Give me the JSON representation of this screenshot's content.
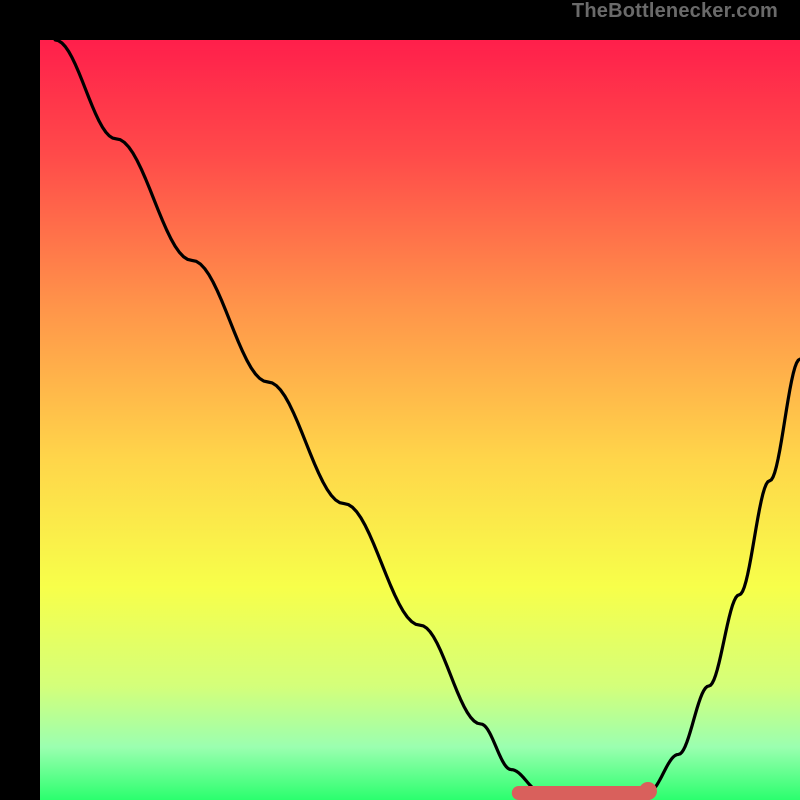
{
  "watermark": {
    "text": "TheBottlenecker.com"
  },
  "chart_data": {
    "type": "line",
    "title": "",
    "xlabel": "",
    "ylabel": "",
    "xlim": [
      0,
      100
    ],
    "ylim": [
      0,
      100
    ],
    "curve_description": "V-shaped curve over vertical rainbow gradient; left branch starts at top-left and descends to a flat trough near x≈64–80 at y≈0, then rises toward upper-right.",
    "series": [
      {
        "name": "bottleneck-curve",
        "color": "#000000",
        "x": [
          2,
          10,
          20,
          30,
          40,
          50,
          58,
          62,
          66,
          70,
          74,
          78,
          80,
          84,
          88,
          92,
          96,
          100
        ],
        "y": [
          100,
          87,
          71,
          55,
          39,
          23,
          10,
          4,
          1,
          0,
          0,
          0,
          1,
          6,
          15,
          27,
          42,
          58
        ]
      }
    ],
    "trough_marker": {
      "name": "trough-highlight",
      "color": "#d9605c",
      "x_range": [
        63,
        80
      ],
      "y": 0,
      "dot_at_x": 80
    },
    "gradient_stops": [
      {
        "offset": 0.0,
        "color": "#ff1f4b"
      },
      {
        "offset": 0.15,
        "color": "#ff4a4a"
      },
      {
        "offset": 0.35,
        "color": "#ff944a"
      },
      {
        "offset": 0.55,
        "color": "#ffd54a"
      },
      {
        "offset": 0.72,
        "color": "#f7ff4a"
      },
      {
        "offset": 0.85,
        "color": "#d4ff7a"
      },
      {
        "offset": 0.93,
        "color": "#9bffb0"
      },
      {
        "offset": 1.0,
        "color": "#2bff6e"
      }
    ]
  }
}
